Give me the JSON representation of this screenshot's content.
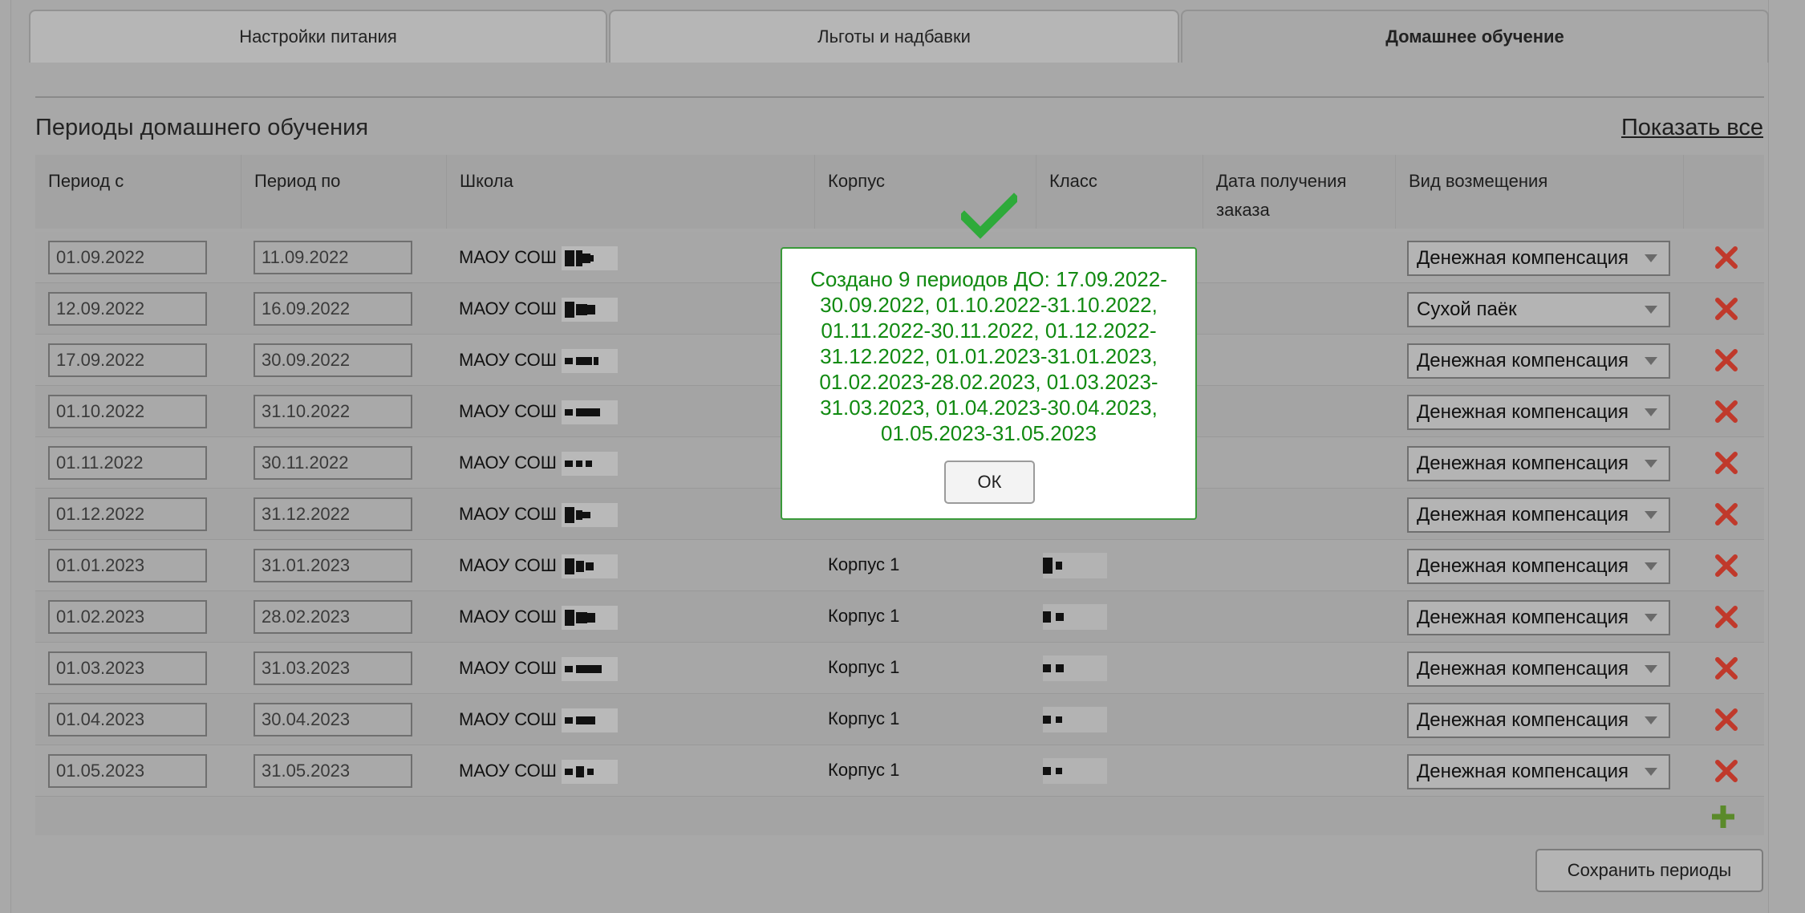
{
  "tabs": [
    {
      "label": "Настройки питания",
      "active": false
    },
    {
      "label": "Льготы и надбавки",
      "active": false
    },
    {
      "label": "Домашнее обучение",
      "active": true
    }
  ],
  "section": {
    "title": "Периоды домашнего обучения",
    "show_all": "Показать все"
  },
  "columns": [
    "Период с",
    "Период по",
    "Школа",
    "Корпус",
    "Класс",
    "Дата получения заказа",
    "Вид возмещения"
  ],
  "rows": [
    {
      "from": "01.09.2022",
      "to": "11.09.2022",
      "school": "МАОУ СОШ",
      "building": "",
      "reimbursement": "Денежная компенсация"
    },
    {
      "from": "12.09.2022",
      "to": "16.09.2022",
      "school": "МАОУ СОШ",
      "building": "",
      "reimbursement": "Сухой паёк"
    },
    {
      "from": "17.09.2022",
      "to": "30.09.2022",
      "school": "МАОУ СОШ",
      "building": "",
      "reimbursement": "Денежная компенсация"
    },
    {
      "from": "01.10.2022",
      "to": "31.10.2022",
      "school": "МАОУ СОШ",
      "building": "",
      "reimbursement": "Денежная компенсация"
    },
    {
      "from": "01.11.2022",
      "to": "30.11.2022",
      "school": "МАОУ СОШ",
      "building": "",
      "reimbursement": "Денежная компенсация"
    },
    {
      "from": "01.12.2022",
      "to": "31.12.2022",
      "school": "МАОУ СОШ",
      "building": "",
      "reimbursement": "Денежная компенсация"
    },
    {
      "from": "01.01.2023",
      "to": "31.01.2023",
      "school": "МАОУ СОШ",
      "building": "Корпус 1",
      "reimbursement": "Денежная компенсация"
    },
    {
      "from": "01.02.2023",
      "to": "28.02.2023",
      "school": "МАОУ СОШ",
      "building": "Корпус 1",
      "reimbursement": "Денежная компенсация"
    },
    {
      "from": "01.03.2023",
      "to": "31.03.2023",
      "school": "МАОУ СОШ",
      "building": "Корпус 1",
      "reimbursement": "Денежная компенсация"
    },
    {
      "from": "01.04.2023",
      "to": "30.04.2023",
      "school": "МАОУ СОШ",
      "building": "Корпус 1",
      "reimbursement": "Денежная компенсация"
    },
    {
      "from": "01.05.2023",
      "to": "31.05.2023",
      "school": "МАОУ СОШ",
      "building": "Корпус 1",
      "reimbursement": "Денежная компенсация"
    }
  ],
  "save_button": "Сохранить периоды",
  "dialog": {
    "message": "Создано 9 периодов ДО: 17.09.2022-30.09.2022, 01.10.2022-31.10.2022, 01.11.2022-30.11.2022, 01.12.2022-31.12.2022, 01.01.2023-31.01.2023, 01.02.2023-28.02.2023, 01.03.2023-31.03.2023, 01.04.2023-30.04.2023, 01.05.2023-31.05.2023",
    "ok": "ОК"
  },
  "colors": {
    "success": "#118a11",
    "delete": "#c0392b",
    "add": "#5a8a2a",
    "check": "#2eaa3a"
  }
}
